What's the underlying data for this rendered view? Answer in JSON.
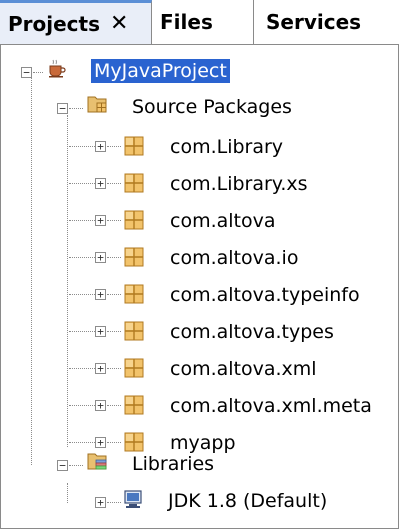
{
  "tabs": [
    {
      "label": "Projects",
      "close": "✕"
    },
    {
      "label": "Files"
    },
    {
      "label": "Services"
    }
  ],
  "tree": {
    "project": "MyJavaProject",
    "source_packages": "Source Packages",
    "packages": [
      "com.Library",
      "com.Library.xs",
      "com.altova",
      "com.altova.io",
      "com.altova.typeinfo",
      "com.altova.types",
      "com.altova.xml",
      "com.altova.xml.meta",
      "myapp"
    ],
    "libraries": "Libraries",
    "jdk": "JDK 1.8 (Default)"
  },
  "colors": {
    "selection": "#2a63d0",
    "package_icon": "#f2c36b",
    "tab_accent": "#5b8fd6"
  }
}
